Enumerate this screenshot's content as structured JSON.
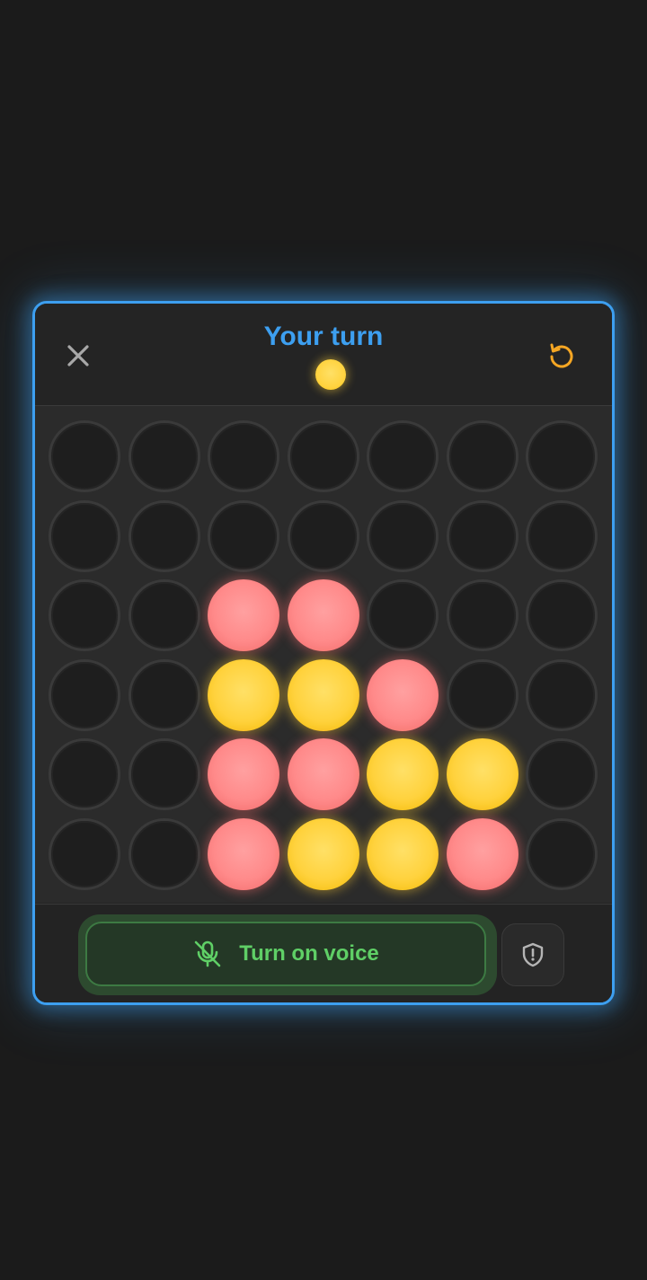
{
  "header": {
    "title": "Your turn",
    "current_player_color": "yellow"
  },
  "board": {
    "columns": 7,
    "rows": 6,
    "grid": [
      [
        "empty",
        "empty",
        "empty",
        "empty",
        "empty",
        "empty",
        "empty"
      ],
      [
        "empty",
        "empty",
        "empty",
        "empty",
        "empty",
        "empty",
        "empty"
      ],
      [
        "empty",
        "empty",
        "red",
        "red",
        "empty",
        "empty",
        "empty"
      ],
      [
        "empty",
        "empty",
        "yellow",
        "yellow",
        "red",
        "empty",
        "empty"
      ],
      [
        "empty",
        "empty",
        "red",
        "red",
        "yellow",
        "yellow",
        "empty"
      ],
      [
        "empty",
        "empty",
        "red",
        "yellow",
        "yellow",
        "red",
        "empty"
      ]
    ]
  },
  "footer": {
    "voice_label": "Turn on voice",
    "voice_icon": "mic-off-icon",
    "report_icon": "shield-alert-icon"
  },
  "colors": {
    "accent_blue": "#3d9ff0",
    "reset_orange": "#f5a623",
    "red_disc": "#ff8a8a",
    "yellow_disc": "#ffd23d",
    "voice_green": "#5fcf66"
  }
}
